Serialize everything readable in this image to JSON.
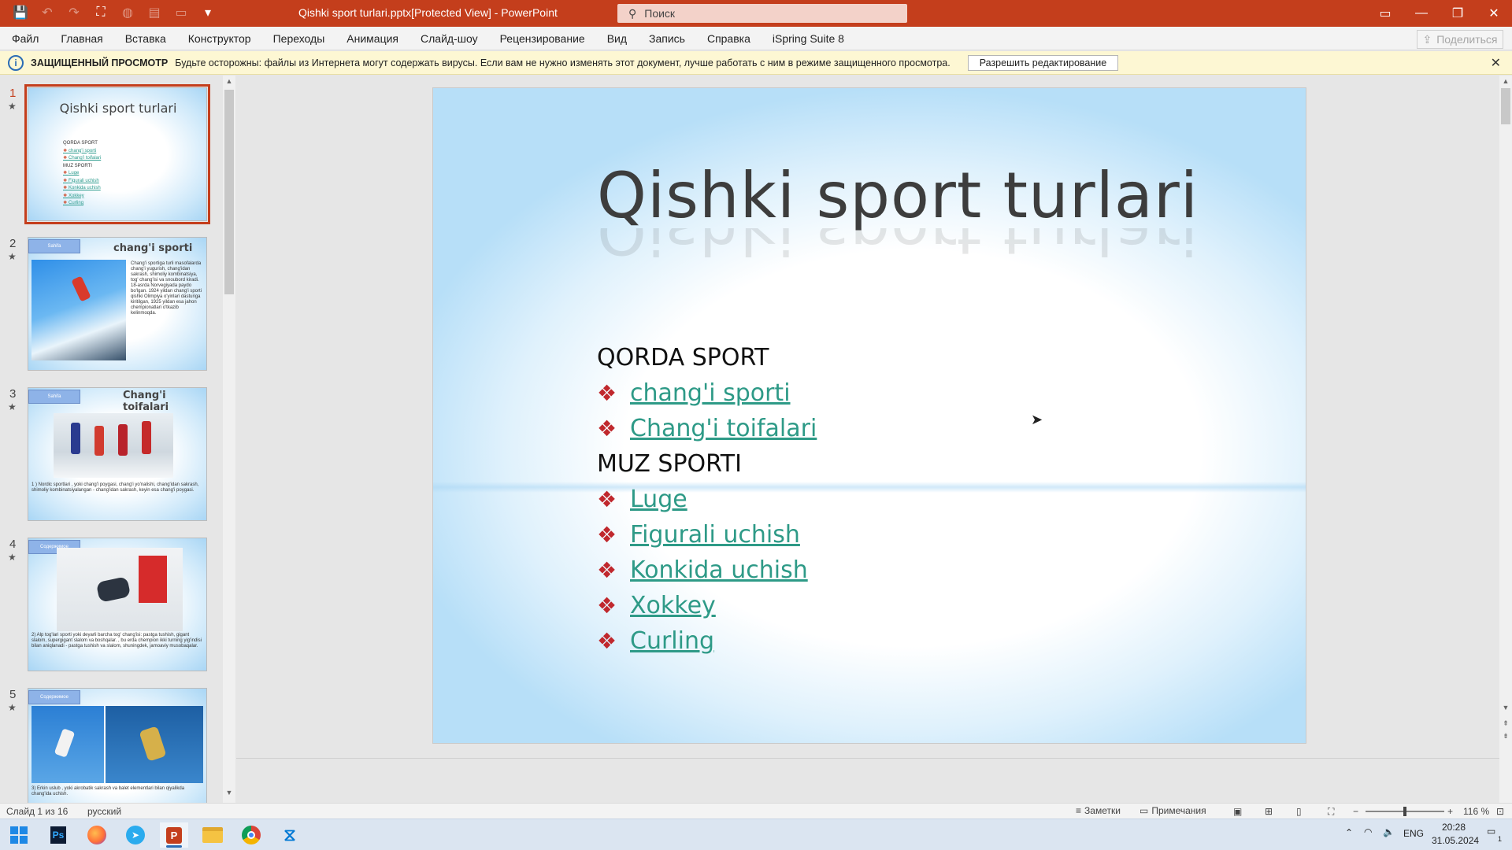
{
  "window": {
    "doc_title": "Qishki sport turlari.pptx[Protected View]  -  PowerPoint",
    "search_placeholder": "Поиск",
    "minimize": "—",
    "restore": "❐",
    "close": "✕",
    "ribbon_display": "▭"
  },
  "menu": {
    "items": [
      "Файл",
      "Главная",
      "Вставка",
      "Конструктор",
      "Переходы",
      "Анимация",
      "Слайд-шоу",
      "Рецензирование",
      "Вид",
      "Запись",
      "Справка",
      "iSpring Suite 8"
    ],
    "share_label": "Поделиться"
  },
  "protected_view": {
    "title": "ЗАЩИЩЕННЫЙ ПРОСМОТР",
    "message": "Будьте осторожны: файлы из Интернета могут содержать вирусы. Если вам не нужно изменять этот документ, лучше работать с ним в режиме защищенного просмотра.",
    "enable_button": "Разрешить редактирование",
    "close": "✕"
  },
  "thumbnails": [
    {
      "num": "1",
      "star": "★",
      "title": "Qishki sport turlari",
      "lines": [
        "QORDA SPORT",
        "chang'i sporti",
        "Chang'i toifalari",
        "MUZ SPORTI",
        "Luge",
        "Figurali uchish",
        "Konkida uchish",
        "Xokkey",
        "Curling"
      ]
    },
    {
      "num": "2",
      "star": "★",
      "title": "chang'i sporti",
      "tag": "Sahifa",
      "text": "Chang'i sportiga turli masofalarda chang'i yugurish, chang'idan sakrash, shimoliy kombinatsiya, tog' chang'isi va snoubord kiradi. 18-asrda Norvegiyada paydo bo'lgan. 1924 yildan chang'i sporti qishki Olimpiya o'yinlari dasturiga kiritilgan, 1925 yildan esa jahon chempionatlari o'tkazib kelinmoqda."
    },
    {
      "num": "3",
      "star": "★",
      "title": "Chang'i toifalari",
      "tag": "Sahifa",
      "text": "1 ) Nordic sportlari , yoki chang'i poygasi, chang'i yo'nalishi, chang'idan sakrash, shimoliy kombinatsiyalangan - chang'idan sakrash, keyin esa chang'i poygasi."
    },
    {
      "num": "4",
      "star": "★",
      "tag": "Содержимое",
      "text": "2) Alp tog'lari sporti yoki deyarli barcha tog' chang'isi: pastga tushish, gigant slalom, supergigant slalom va boshqalar. , bu erda chempion ikki turning yig'indisi bilan aniqlanadi - pastga tushish va slalom, shuningdek, jamoaviy musobaqalar."
    },
    {
      "num": "5",
      "star": "★",
      "tag": "Содержимое",
      "text": "3) Erkin uslub , yoki akrobatik sakrash va balet elementlari bilan qiyalikda chang'ida uchish."
    }
  ],
  "slide": {
    "title": "Qishki sport turlari",
    "items": [
      {
        "text": "QORDA SPORT",
        "kind": "head"
      },
      {
        "text": "chang'i sporti",
        "kind": "link"
      },
      {
        "text": "Chang'i toifalari",
        "kind": "link"
      },
      {
        "text": "MUZ SPORTI",
        "kind": "head"
      },
      {
        "text": "Luge",
        "kind": "link"
      },
      {
        "text": "Figurali uchish",
        "kind": "link"
      },
      {
        "text": "Konkida uchish",
        "kind": "link"
      },
      {
        "text": "Xokkey",
        "kind": "link"
      },
      {
        "text": "Curling",
        "kind": "link"
      }
    ],
    "bullet": "❖"
  },
  "status": {
    "slide_info": "Слайд 1 из 16",
    "language": "русский",
    "notes": "Заметки",
    "comments": "Примечания",
    "zoom_minus": "−",
    "zoom_plus": "+",
    "zoom": "116 %"
  },
  "taskbar": {
    "apps": [
      "start",
      "photoshop",
      "firefox",
      "telegram",
      "powerpoint",
      "explorer",
      "chrome",
      "vscode"
    ],
    "lang": "ENG",
    "time": "20:28",
    "date": "31.05.2024",
    "notif_count": "1"
  },
  "colors": {
    "accent": "#c43e1c",
    "link": "#2e9a87",
    "bullet": "#c0282d"
  }
}
